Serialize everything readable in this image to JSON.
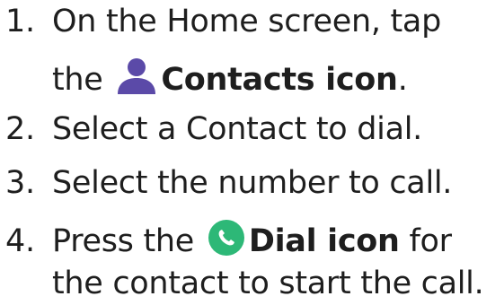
{
  "steps": [
    {
      "number": "1.",
      "line1": "On the Home screen, tap",
      "line2_prefix": "the",
      "icon": "contacts-icon",
      "bold": "Contacts icon",
      "suffix": "."
    },
    {
      "number": "2.",
      "text": "Select a Contact to dial."
    },
    {
      "number": "3.",
      "text": "Select the number to call."
    },
    {
      "number": "4.",
      "prefix": "Press the",
      "icon": "dial-icon",
      "bold": "Dial icon",
      "suffix": " for",
      "line2": "the contact to start the call."
    }
  ],
  "colors": {
    "text": "#1e1e1e",
    "contacts_icon": "#5b4aa8",
    "dial_icon": "#2db877"
  }
}
